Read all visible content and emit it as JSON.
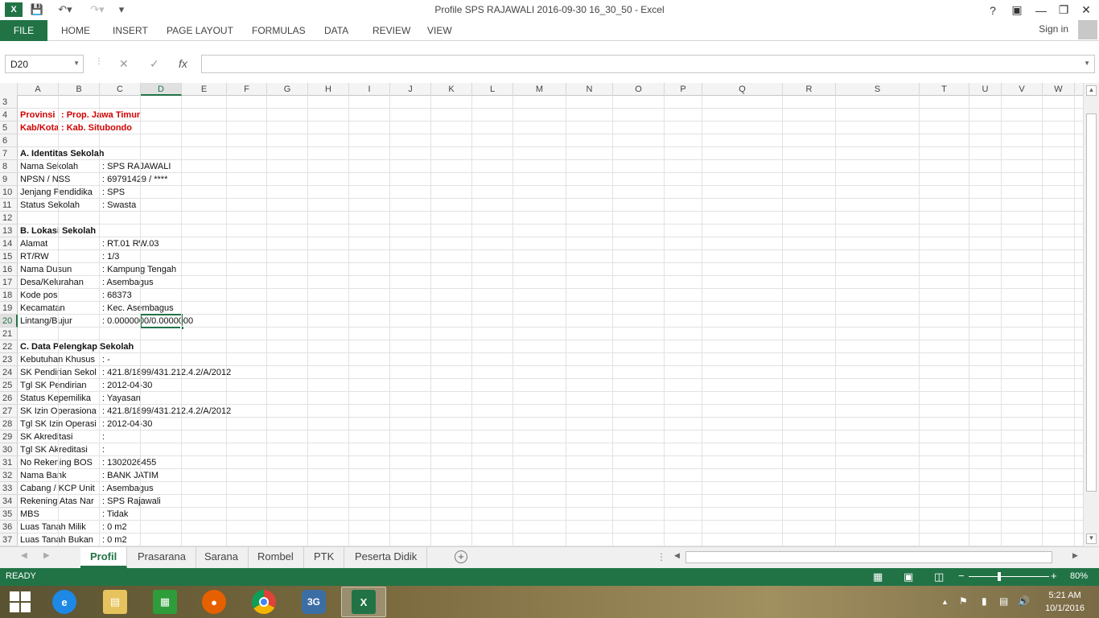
{
  "window": {
    "title": "Profile SPS RAJAWALI 2016-09-30 16_30_50 - Excel"
  },
  "ribbon": {
    "tabs": [
      "FILE",
      "HOME",
      "INSERT",
      "PAGE LAYOUT",
      "FORMULAS",
      "DATA",
      "REVIEW",
      "VIEW"
    ],
    "sign_in": "Sign in"
  },
  "formula_bar": {
    "name_box": "D20",
    "fx": "fx",
    "value": ""
  },
  "columns": [
    "A",
    "B",
    "C",
    "D",
    "E",
    "F",
    "G",
    "H",
    "I",
    "J",
    "K",
    "L",
    "M",
    "N",
    "O",
    "P",
    "Q",
    "R",
    "S",
    "T",
    "U",
    "V",
    "W"
  ],
  "selected_column": "D",
  "rows": [
    "3",
    "4",
    "5",
    "6",
    "7",
    "8",
    "9",
    "10",
    "11",
    "12",
    "13",
    "14",
    "15",
    "16",
    "17",
    "18",
    "19",
    "20",
    "21",
    "22",
    "23",
    "24",
    "25",
    "26",
    "27",
    "28",
    "29",
    "30",
    "31",
    "32",
    "33",
    "34",
    "35",
    "36",
    "37"
  ],
  "selected_row": "20",
  "sheet": {
    "r4a": "Provinsi",
    "r4b": ": Prop. Jawa Timur",
    "r5a": "Kab/Kota",
    "r5b": ": Kab. Situbondo",
    "r7a": "A. Identitas Sekolah",
    "r8a": "Nama Sekolah",
    "r8c": ": SPS RAJAWALI",
    "r9a": "NPSN / NSS",
    "r9c": ": 69791429 / ****",
    "r10a": "Jenjang Pendidika",
    "r10c": ": SPS",
    "r11a": "Status Sekolah",
    "r11c": ": Swasta",
    "r13a": "B. Lokasi Sekolah",
    "r14a": "Alamat",
    "r14c": ": RT.01 RW.03",
    "r15a": "RT/RW",
    "r15c": ": 1/3",
    "r16a": "Nama Dusun",
    "r16c": ": Kampung Tengah",
    "r17a": "Desa/Kelurahan",
    "r17c": ": Asembagus",
    "r18a": "Kode pos",
    "r18c": ": 68373",
    "r19a": "Kecamatan",
    "r19c": ": Kec. Asembagus",
    "r20a": "Lintang/Bujur",
    "r20c": ": 0.0000000/0.0000000",
    "r22a": "C. Data Pelengkap Sekolah",
    "r23a": "Kebutuhan Khusus",
    "r23c": ": -",
    "r24a": "SK Pendirian Sekol",
    "r24c": ": 421.8/1899/431.212.4.2/A/2012",
    "r25a": "Tgl SK Pendirian",
    "r25c": ": 2012-04-30",
    "r26a": "Status Kepemilika",
    "r26c": ": Yayasan",
    "r27a": "SK Izin Operasiona",
    "r27c": ": 421.8/1899/431.212.4.2/A/2012",
    "r28a": "Tgl SK Izin Operasi",
    "r28c": ": 2012-04-30",
    "r29a": "SK Akreditasi",
    "r29c": ":",
    "r30a": "Tgl SK Akreditasi",
    "r30c": ":",
    "r31a": "No Rekening BOS",
    "r31c": ": 1302026455",
    "r32a": "Nama Bank",
    "r32c": ": BANK JATIM",
    "r33a": "Cabang / KCP Unit",
    "r33c": ": Asembagus",
    "r34a": "Rekening Atas Nar",
    "r34c": ": SPS Rajawali",
    "r35a": "MBS",
    "r35c": ": Tidak",
    "r36a": "Luas Tanah Milik",
    "r36c": ": 0 m2",
    "r37a": "Luas Tanah Bukan",
    "r37c": ": 0 m2"
  },
  "sheet_tabs": [
    "Profil",
    "Prasarana",
    "Sarana",
    "Rombel",
    "PTK",
    "Peserta Didik"
  ],
  "active_sheet": "Profil",
  "status": {
    "ready": "READY",
    "zoom": "80%"
  },
  "taskbar": {
    "time": "5:21 AM",
    "date": "10/1/2016"
  },
  "colors": {
    "accent": "#217346",
    "label_red": "#d00000"
  }
}
